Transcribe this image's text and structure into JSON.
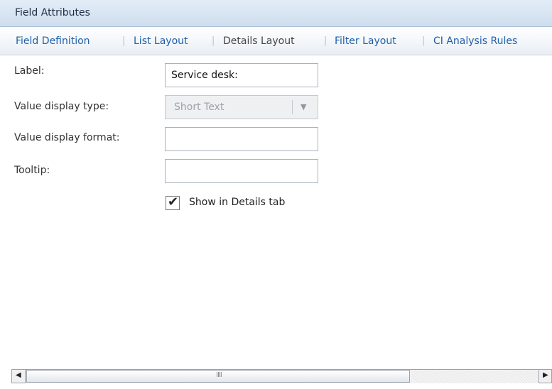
{
  "header": {
    "title": "Field Attributes"
  },
  "tabs": [
    {
      "label": "Field Definition"
    },
    {
      "label": "List Layout"
    },
    {
      "label": "Details Layout"
    },
    {
      "label": "Filter Layout"
    },
    {
      "label": "CI Analysis Rules"
    }
  ],
  "active_tab": "Details Layout",
  "form": {
    "label_label": "Label:",
    "label_value": "Service desk:",
    "display_type_label": "Value display type:",
    "display_type_value": "Short Text",
    "display_format_label": "Value display format:",
    "display_format_value": "",
    "tooltip_label": "Tooltip:",
    "tooltip_value": "",
    "show_in_details_label": "Show in Details tab",
    "show_in_details_checked": true
  },
  "scrollbar": {
    "thumb_grip": "IIII"
  },
  "colors": {
    "link": "#1f5fa8",
    "header_bg": "#d8e4f2"
  }
}
